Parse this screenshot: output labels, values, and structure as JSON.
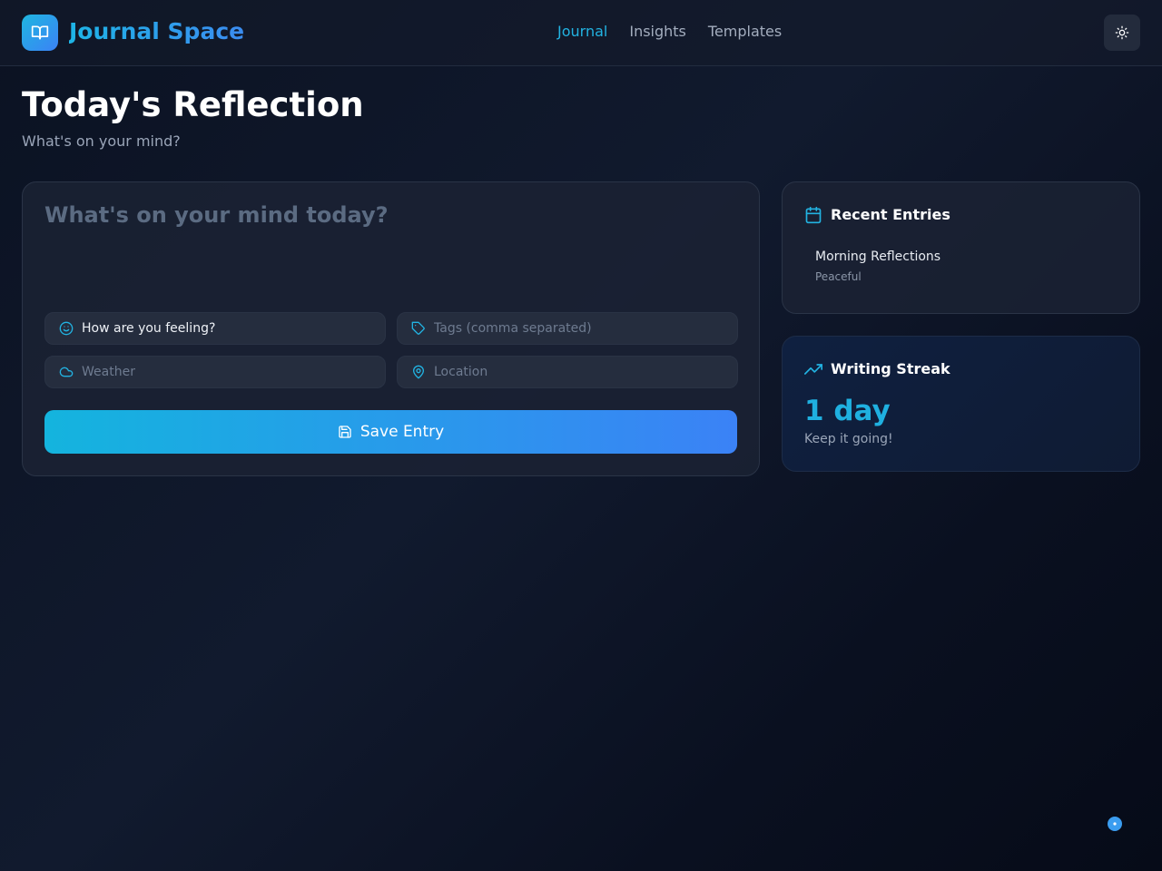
{
  "app": {
    "name": "Journal Space"
  },
  "nav": {
    "items": [
      {
        "label": "Journal",
        "active": true
      },
      {
        "label": "Insights"
      },
      {
        "label": "Templates"
      }
    ]
  },
  "header": {
    "theme_toggle_icon": "sun-icon"
  },
  "page": {
    "title": "Today's Reflection",
    "subtitle": "What's on your mind?"
  },
  "editor": {
    "placeholder": "What's on your mind today?",
    "mood_label": "How are you feeling?",
    "tags_placeholder": "Tags (comma separated)",
    "weather_placeholder": "Weather",
    "location_placeholder": "Location",
    "save_label": "Save Entry"
  },
  "recent": {
    "title": "Recent Entries",
    "entries": [
      {
        "title": "Morning Reflections",
        "mood": "Peaceful"
      }
    ]
  },
  "streak": {
    "title": "Writing Streak",
    "value": "1 day",
    "caption": "Keep it going!"
  },
  "colors": {
    "accent": "#22b3e2",
    "gradient_start": "#14b4de",
    "gradient_end": "#3b82f6",
    "background": "#0b1222"
  }
}
